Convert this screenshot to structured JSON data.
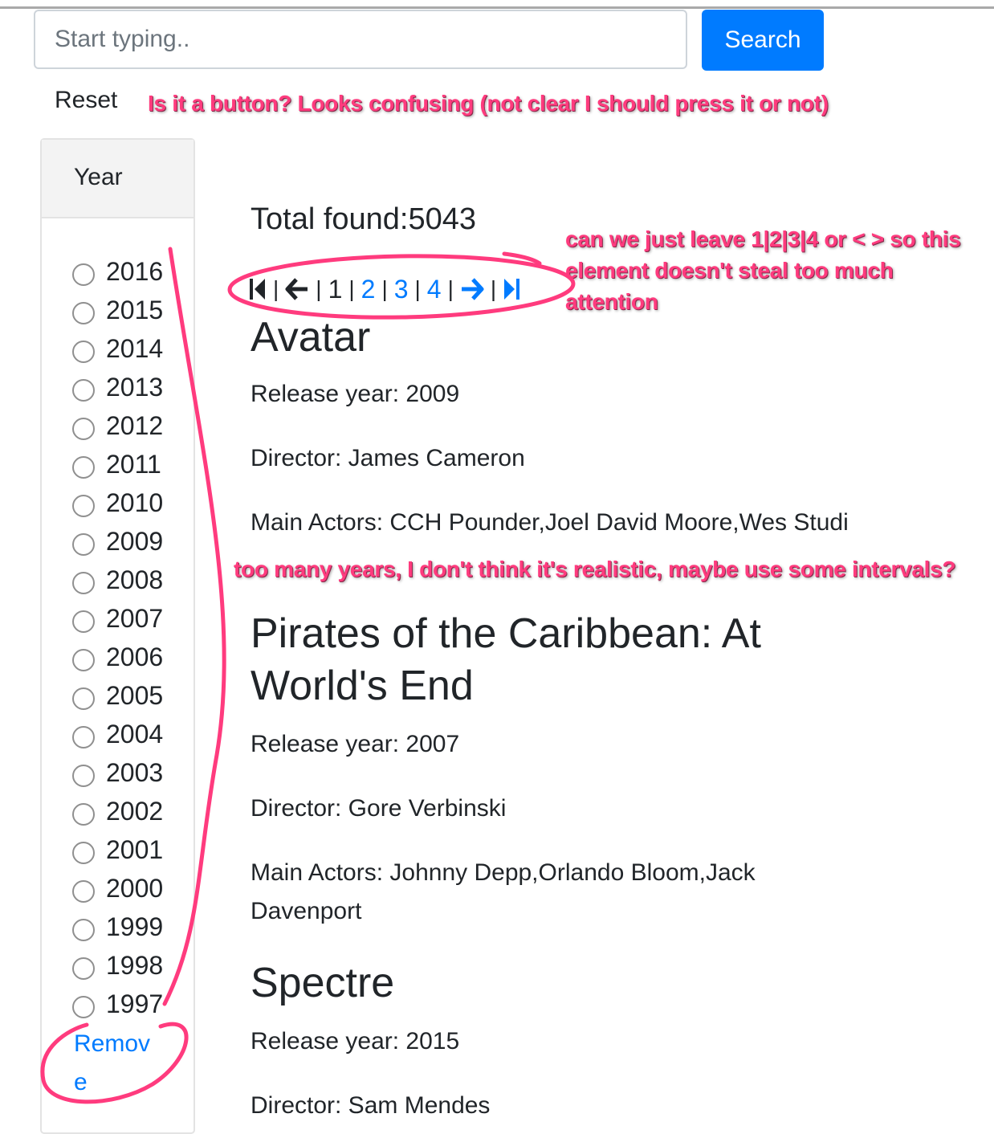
{
  "search": {
    "placeholder": "Start typing..",
    "button_label": "Search"
  },
  "reset_label": "Reset",
  "annotations": {
    "reset_note": "Is it a button? Looks confusing (not clear I should press it or not)",
    "pager_note": "can we just leave 1|2|3|4 or < > so this element doesn't steal too much attention",
    "years_note": "too many years, I don't think it's realistic, maybe use some intervals?",
    "color": "#ff3b7e"
  },
  "sidebar": {
    "header": "Year",
    "years": [
      "2016",
      "2015",
      "2014",
      "2013",
      "2012",
      "2011",
      "2010",
      "2009",
      "2008",
      "2007",
      "2006",
      "2005",
      "2004",
      "2003",
      "2002",
      "2001",
      "2000",
      "1999",
      "1998",
      "1997"
    ],
    "remove_label": "Remove"
  },
  "results": {
    "total_label": "Total found:5043",
    "pager": {
      "current": "1",
      "pages": [
        "2",
        "3",
        "4"
      ],
      "icons": [
        "first-page-icon",
        "prev-page-icon",
        "next-page-icon",
        "last-page-icon"
      ]
    },
    "movies": [
      {
        "title": "Avatar",
        "release": "Release year: 2009",
        "director": "Director: James Cameron",
        "actors": "Main Actors: CCH Pounder,Joel David Moore,Wes Studi"
      },
      {
        "title": "Pirates of the Caribbean: At World's End",
        "release": "Release year: 2007",
        "director": "Director: Gore Verbinski",
        "actors": "Main Actors: Johnny Depp,Orlando Bloom,Jack Davenport"
      },
      {
        "title": "Spectre",
        "release": "Release year: 2015",
        "director": "Director: Sam Mendes"
      }
    ]
  },
  "colors": {
    "primary": "#007bff",
    "text": "#212529",
    "annotation": "#ff3b7e"
  }
}
